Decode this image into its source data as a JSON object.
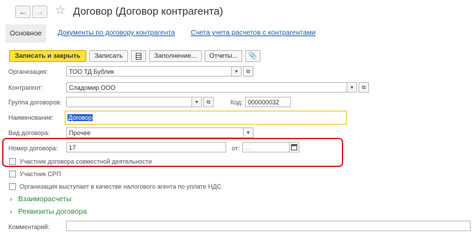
{
  "header": {
    "title": "Договор (Договор контрагента)",
    "back_icon": "arrow-left-icon",
    "forward_icon": "arrow-right-icon",
    "star_icon": "star-icon"
  },
  "tabs": [
    {
      "label": "Основное",
      "active": true
    },
    {
      "label": "Документы по договору контрагента",
      "active": false
    },
    {
      "label": "Счета учета расчетов с контрагентами",
      "active": false
    }
  ],
  "toolbar": {
    "save_close": "Записать и закрыть",
    "save": "Записать",
    "filling": "Заполнение...",
    "reports": "Отчеты...",
    "list_icon": "list-icon",
    "attach_icon": "paperclip-icon"
  },
  "form": {
    "organization": {
      "label": "Организация:",
      "value": "ТОО ТД Бублик"
    },
    "counterparty": {
      "label": "Контрагент:",
      "value": "Сладомир ООО"
    },
    "group": {
      "label": "Группа договоров:",
      "value": ""
    },
    "code": {
      "label": "Код:",
      "value": "000000032"
    },
    "name": {
      "label": "Наименование:",
      "value": "Договор"
    },
    "kind": {
      "label": "Вид договора:",
      "value": "Прочее"
    },
    "number": {
      "label": "Номер договора:",
      "value": "17"
    },
    "date": {
      "label": "от:",
      "value": ". ."
    },
    "joint_activity": {
      "label": "Участник договора совместной деятельности",
      "checked": false
    },
    "srp": {
      "label": "Участник СРП",
      "checked": false
    },
    "tax_agent": {
      "label": "Организация выступает в качестве налогового агента по уплате НДС",
      "checked": false
    },
    "settlements": "Взаиморасчеты",
    "requisites": "Реквизиты договора",
    "comment": {
      "label": "Комментарий:",
      "value": ""
    }
  },
  "colors": {
    "primary_button": "#ffe33a",
    "highlight_border": "#d8232a",
    "link": "#1f5ca8",
    "expander": "#2f8a3a"
  }
}
